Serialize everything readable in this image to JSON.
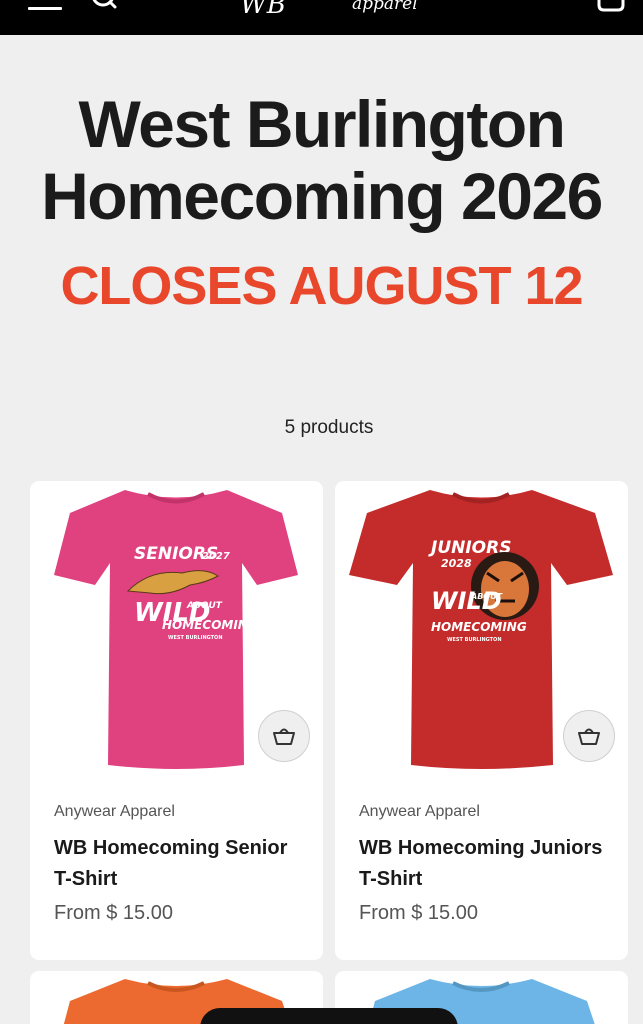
{
  "header": {
    "logo_text": "WB",
    "logo_sub": "apparel",
    "icons": [
      "menu-icon",
      "search-icon",
      "cart-icon"
    ]
  },
  "collection": {
    "title_line1": "West Burlington",
    "title_line2": "Homecoming 2026",
    "subtitle": "CLOSES AUGUST 12",
    "product_count": "5 products"
  },
  "colors": {
    "accent": "#e9472c",
    "header_bg": "#000000",
    "page_bg": "#efefef"
  },
  "products": [
    {
      "vendor": "Anywear Apparel",
      "title": "WB Homecoming Senior T-Shirt",
      "price": "From $ 15.00",
      "shirt_color": "#e0417f",
      "print_line1": "SENIORS",
      "print_year": "2027",
      "print_line2": "WILD",
      "print_line3": "ABOUT",
      "print_line4": "HOMECOMING",
      "print_line5": "WEST BURLINGTON"
    },
    {
      "vendor": "Anywear Apparel",
      "title": "WB Homecoming Juniors T-Shirt",
      "price": "From $ 15.00",
      "shirt_color": "#c42b2b",
      "print_line1": "JUNIORS",
      "print_year": "2028",
      "print_line2": "WILD",
      "print_line3": "ABOUT",
      "print_line4": "HOMECOMING",
      "print_line5": "WEST BURLINGTON"
    },
    {
      "shirt_color": "#ec6a2f"
    },
    {
      "shirt_color": "#6cb5e6"
    }
  ]
}
